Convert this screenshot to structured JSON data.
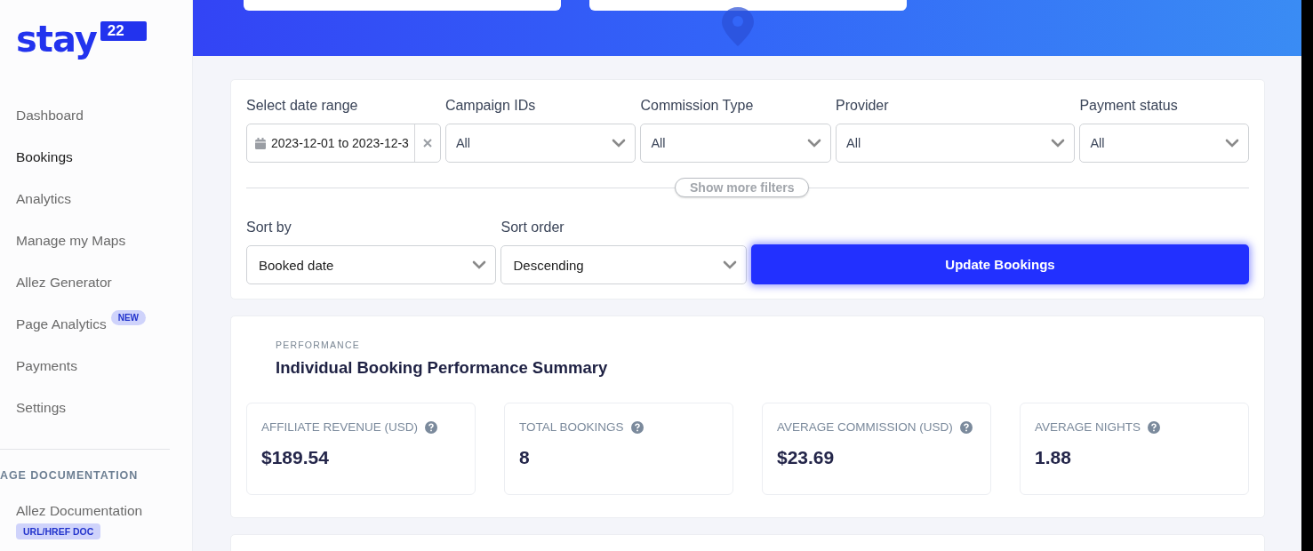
{
  "logo": {
    "word": "stay",
    "badge": "22"
  },
  "sidebar": {
    "items": [
      {
        "label": "Dashboard",
        "selected": false
      },
      {
        "label": "Bookings",
        "selected": true
      },
      {
        "label": "Analytics",
        "selected": false
      },
      {
        "label": "Manage my Maps",
        "selected": false
      },
      {
        "label": "Allez Generator",
        "selected": false
      },
      {
        "label": "Page Analytics",
        "selected": false,
        "badge": "NEW"
      },
      {
        "label": "Payments",
        "selected": false
      },
      {
        "label": "Settings",
        "selected": false
      }
    ],
    "section": {
      "heading": "AGE DOCUMENTATION",
      "items": [
        {
          "label": "Allez Documentation",
          "selected": false,
          "badge": "URL/HREF DOC"
        }
      ]
    }
  },
  "filters": [
    {
      "kind": "date",
      "label": "Select date range",
      "value": "2023-12-01 to 2023-12-3"
    },
    {
      "kind": "select",
      "label": "Campaign IDs",
      "value": "All"
    },
    {
      "kind": "select",
      "label": "Commission Type",
      "value": "All"
    },
    {
      "kind": "select",
      "label": "Provider",
      "value": "All"
    },
    {
      "kind": "select",
      "label": "Payment status",
      "value": "All"
    }
  ],
  "more_filters": "Show more filters",
  "sort": [
    {
      "label": "Sort by",
      "value": "Booked date"
    },
    {
      "label": "Sort order",
      "value": "Descending"
    }
  ],
  "update_button": "Update Bookings",
  "performance": {
    "eyebrow": "PERFORMANCE",
    "title": "Individual Booking Performance Summary",
    "stats": [
      {
        "label": "AFFILIATE REVENUE (USD)",
        "value": "$189.54"
      },
      {
        "label": "TOTAL BOOKINGS",
        "value": "8"
      },
      {
        "label": "AVERAGE COMMISSION (USD)",
        "value": "$23.69"
      },
      {
        "label": "AVERAGE NIGHTS",
        "value": "1.88"
      }
    ]
  }
}
